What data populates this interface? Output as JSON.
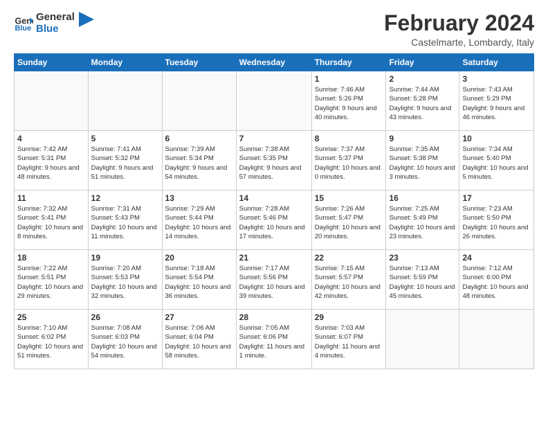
{
  "logo": {
    "line1": "General",
    "line2": "Blue"
  },
  "title": "February 2024",
  "subtitle": "Castelmarte, Lombardy, Italy",
  "weekdays": [
    "Sunday",
    "Monday",
    "Tuesday",
    "Wednesday",
    "Thursday",
    "Friday",
    "Saturday"
  ],
  "weeks": [
    [
      {
        "day": "",
        "info": ""
      },
      {
        "day": "",
        "info": ""
      },
      {
        "day": "",
        "info": ""
      },
      {
        "day": "",
        "info": ""
      },
      {
        "day": "1",
        "info": "Sunrise: 7:46 AM\nSunset: 5:26 PM\nDaylight: 9 hours\nand 40 minutes."
      },
      {
        "day": "2",
        "info": "Sunrise: 7:44 AM\nSunset: 5:28 PM\nDaylight: 9 hours\nand 43 minutes."
      },
      {
        "day": "3",
        "info": "Sunrise: 7:43 AM\nSunset: 5:29 PM\nDaylight: 9 hours\nand 46 minutes."
      }
    ],
    [
      {
        "day": "4",
        "info": "Sunrise: 7:42 AM\nSunset: 5:31 PM\nDaylight: 9 hours\nand 48 minutes."
      },
      {
        "day": "5",
        "info": "Sunrise: 7:41 AM\nSunset: 5:32 PM\nDaylight: 9 hours\nand 51 minutes."
      },
      {
        "day": "6",
        "info": "Sunrise: 7:39 AM\nSunset: 5:34 PM\nDaylight: 9 hours\nand 54 minutes."
      },
      {
        "day": "7",
        "info": "Sunrise: 7:38 AM\nSunset: 5:35 PM\nDaylight: 9 hours\nand 57 minutes."
      },
      {
        "day": "8",
        "info": "Sunrise: 7:37 AM\nSunset: 5:37 PM\nDaylight: 10 hours\nand 0 minutes."
      },
      {
        "day": "9",
        "info": "Sunrise: 7:35 AM\nSunset: 5:38 PM\nDaylight: 10 hours\nand 3 minutes."
      },
      {
        "day": "10",
        "info": "Sunrise: 7:34 AM\nSunset: 5:40 PM\nDaylight: 10 hours\nand 5 minutes."
      }
    ],
    [
      {
        "day": "11",
        "info": "Sunrise: 7:32 AM\nSunset: 5:41 PM\nDaylight: 10 hours\nand 8 minutes."
      },
      {
        "day": "12",
        "info": "Sunrise: 7:31 AM\nSunset: 5:43 PM\nDaylight: 10 hours\nand 11 minutes."
      },
      {
        "day": "13",
        "info": "Sunrise: 7:29 AM\nSunset: 5:44 PM\nDaylight: 10 hours\nand 14 minutes."
      },
      {
        "day": "14",
        "info": "Sunrise: 7:28 AM\nSunset: 5:46 PM\nDaylight: 10 hours\nand 17 minutes."
      },
      {
        "day": "15",
        "info": "Sunrise: 7:26 AM\nSunset: 5:47 PM\nDaylight: 10 hours\nand 20 minutes."
      },
      {
        "day": "16",
        "info": "Sunrise: 7:25 AM\nSunset: 5:49 PM\nDaylight: 10 hours\nand 23 minutes."
      },
      {
        "day": "17",
        "info": "Sunrise: 7:23 AM\nSunset: 5:50 PM\nDaylight: 10 hours\nand 26 minutes."
      }
    ],
    [
      {
        "day": "18",
        "info": "Sunrise: 7:22 AM\nSunset: 5:51 PM\nDaylight: 10 hours\nand 29 minutes."
      },
      {
        "day": "19",
        "info": "Sunrise: 7:20 AM\nSunset: 5:53 PM\nDaylight: 10 hours\nand 32 minutes."
      },
      {
        "day": "20",
        "info": "Sunrise: 7:18 AM\nSunset: 5:54 PM\nDaylight: 10 hours\nand 36 minutes."
      },
      {
        "day": "21",
        "info": "Sunrise: 7:17 AM\nSunset: 5:56 PM\nDaylight: 10 hours\nand 39 minutes."
      },
      {
        "day": "22",
        "info": "Sunrise: 7:15 AM\nSunset: 5:57 PM\nDaylight: 10 hours\nand 42 minutes."
      },
      {
        "day": "23",
        "info": "Sunrise: 7:13 AM\nSunset: 5:59 PM\nDaylight: 10 hours\nand 45 minutes."
      },
      {
        "day": "24",
        "info": "Sunrise: 7:12 AM\nSunset: 6:00 PM\nDaylight: 10 hours\nand 48 minutes."
      }
    ],
    [
      {
        "day": "25",
        "info": "Sunrise: 7:10 AM\nSunset: 6:02 PM\nDaylight: 10 hours\nand 51 minutes."
      },
      {
        "day": "26",
        "info": "Sunrise: 7:08 AM\nSunset: 6:03 PM\nDaylight: 10 hours\nand 54 minutes."
      },
      {
        "day": "27",
        "info": "Sunrise: 7:06 AM\nSunset: 6:04 PM\nDaylight: 10 hours\nand 58 minutes."
      },
      {
        "day": "28",
        "info": "Sunrise: 7:05 AM\nSunset: 6:06 PM\nDaylight: 11 hours\nand 1 minute."
      },
      {
        "day": "29",
        "info": "Sunrise: 7:03 AM\nSunset: 6:07 PM\nDaylight: 11 hours\nand 4 minutes."
      },
      {
        "day": "",
        "info": ""
      },
      {
        "day": "",
        "info": ""
      }
    ]
  ]
}
